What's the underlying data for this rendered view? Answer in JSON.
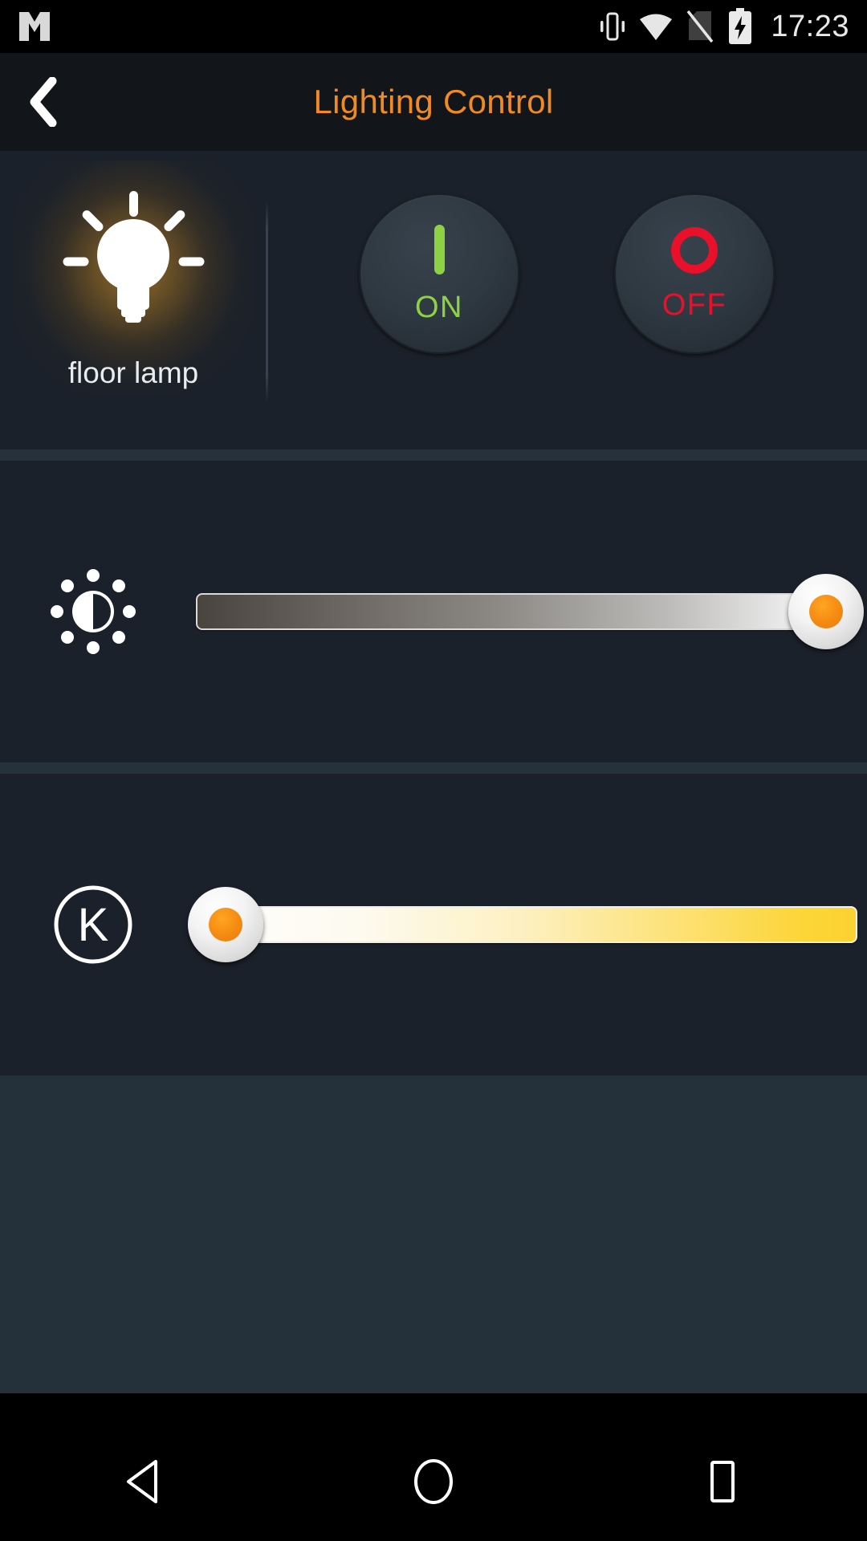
{
  "status_bar": {
    "app_icon": "m-logo-icon",
    "icons": [
      "vibrate-icon",
      "wifi-icon",
      "no-sim-icon",
      "battery-charging-icon"
    ],
    "time": "17:23"
  },
  "title_bar": {
    "back_icon": "back-chevron-icon",
    "title": "Lighting Control",
    "title_color": "#f08a22"
  },
  "lamp_section": {
    "bulb_icon": "light-bulb-on-icon",
    "label": "floor lamp",
    "glow_color": "#ffb22d",
    "buttons": [
      {
        "label": "ON",
        "glyph": "power-line-icon",
        "color": "#8ed243"
      },
      {
        "label": "OFF",
        "glyph": "power-circle-icon",
        "color": "#e8102a"
      }
    ]
  },
  "brightness_section": {
    "icon": "brightness-sun-icon",
    "slider_name": "brightness-slider",
    "value_percent": 100,
    "gradient_from": "#4a443f",
    "gradient_to": "#f4f4f4",
    "thumb_color": "#f58a12"
  },
  "kelvin_section": {
    "icon": "kelvin-temperature-icon",
    "icon_letter": "K",
    "slider_name": "color-temperature-slider",
    "value_percent": 0,
    "gradient_from": "#fefdfa",
    "gradient_to": "#fcd231",
    "thumb_color": "#f58a12"
  },
  "nav_bar": {
    "buttons": [
      "back-triangle-icon",
      "home-circle-icon",
      "recents-square-icon"
    ]
  }
}
